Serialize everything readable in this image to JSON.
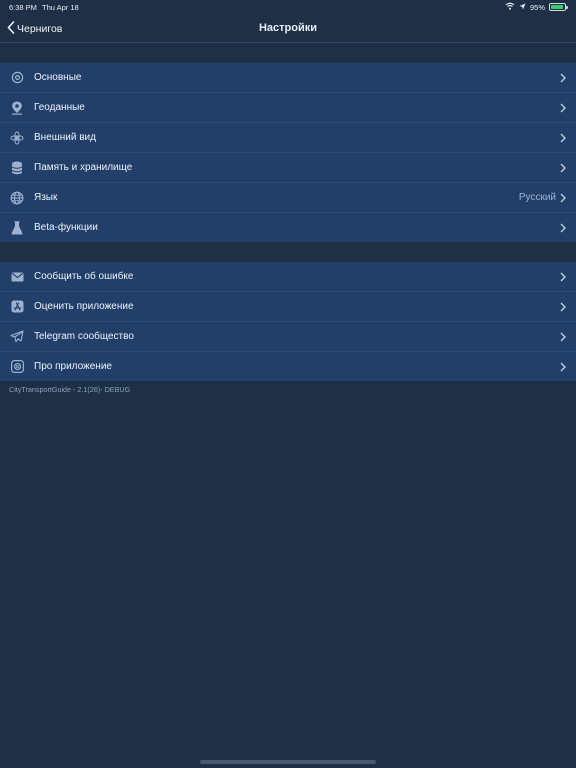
{
  "status_bar": {
    "time": "6:38 PM",
    "date": "Thu Apr 18",
    "battery_percent": "95%",
    "battery_level": 0.95
  },
  "navbar": {
    "back_label": "Чернигов",
    "title": "Настройки"
  },
  "settings": {
    "items": [
      {
        "label": "Основные",
        "icon": "gear-icon"
      },
      {
        "label": "Геоданные",
        "icon": "location-pin-icon"
      },
      {
        "label": "Внешний вид",
        "icon": "appearance-icon"
      },
      {
        "label": "Память и хранилище",
        "icon": "database-icon"
      },
      {
        "label": "Язык",
        "icon": "globe-icon",
        "value": "Русский"
      },
      {
        "label": "Beta-функции",
        "icon": "flask-icon"
      }
    ]
  },
  "support": {
    "items": [
      {
        "label": "Сообщить об ошибке",
        "icon": "mail-icon"
      },
      {
        "label": "Оценить приложение",
        "icon": "app-store-icon"
      },
      {
        "label": "Telegram сообщество",
        "icon": "telegram-icon"
      },
      {
        "label": "Про приложение",
        "icon": "about-icon"
      }
    ]
  },
  "footer": {
    "version": "CityTransportGuide - 2.1(26)- DEBUG"
  },
  "colors": {
    "background": "#1f2f45",
    "row_background": "#223f69",
    "icon": "#9eb2cf"
  }
}
